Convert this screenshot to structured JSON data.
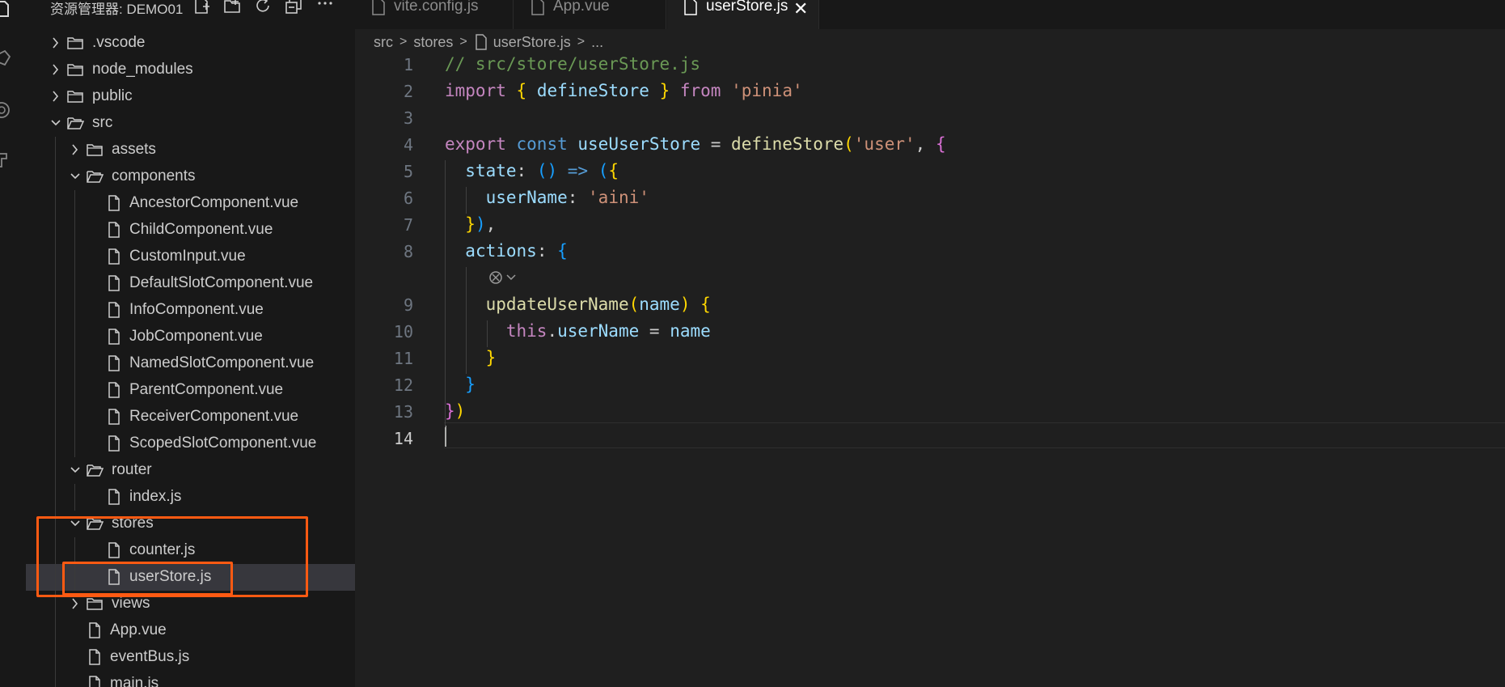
{
  "explorer": {
    "title": "资源管理器: DEMO01",
    "actions": [
      {
        "name": "new-file-icon"
      },
      {
        "name": "new-folder-icon"
      },
      {
        "name": "refresh-icon"
      },
      {
        "name": "collapse-all-icon"
      },
      {
        "name": "more-actions-icon"
      }
    ],
    "items": [
      {
        "label": ".vscode",
        "type": "folder",
        "depth": 0,
        "expanded": false
      },
      {
        "label": "node_modules",
        "type": "folder",
        "depth": 0,
        "expanded": false
      },
      {
        "label": "public",
        "type": "folder",
        "depth": 0,
        "expanded": false
      },
      {
        "label": "src",
        "type": "folder",
        "depth": 0,
        "expanded": true
      },
      {
        "label": "assets",
        "type": "folder",
        "depth": 1,
        "expanded": false
      },
      {
        "label": "components",
        "type": "folder",
        "depth": 1,
        "expanded": true
      },
      {
        "label": "AncestorComponent.vue",
        "type": "file",
        "depth": 2
      },
      {
        "label": "ChildComponent.vue",
        "type": "file",
        "depth": 2
      },
      {
        "label": "CustomInput.vue",
        "type": "file",
        "depth": 2
      },
      {
        "label": "DefaultSlotComponent.vue",
        "type": "file",
        "depth": 2
      },
      {
        "label": "InfoComponent.vue",
        "type": "file",
        "depth": 2
      },
      {
        "label": "JobComponent.vue",
        "type": "file",
        "depth": 2
      },
      {
        "label": "NamedSlotComponent.vue",
        "type": "file",
        "depth": 2
      },
      {
        "label": "ParentComponent.vue",
        "type": "file",
        "depth": 2
      },
      {
        "label": "ReceiverComponent.vue",
        "type": "file",
        "depth": 2
      },
      {
        "label": "ScopedSlotComponent.vue",
        "type": "file",
        "depth": 2
      },
      {
        "label": "router",
        "type": "folder",
        "depth": 1,
        "expanded": true
      },
      {
        "label": "index.js",
        "type": "file",
        "depth": 2
      },
      {
        "label": "stores",
        "type": "folder",
        "depth": 1,
        "expanded": true
      },
      {
        "label": "counter.js",
        "type": "file",
        "depth": 2
      },
      {
        "label": "userStore.js",
        "type": "file",
        "depth": 2,
        "selected": true
      },
      {
        "label": "views",
        "type": "folder",
        "depth": 1,
        "expanded": false
      },
      {
        "label": "App.vue",
        "type": "file",
        "depth": 1
      },
      {
        "label": "eventBus.js",
        "type": "file",
        "depth": 1
      },
      {
        "label": "main.js",
        "type": "file",
        "depth": 1
      }
    ]
  },
  "tabs": [
    {
      "label": "vite.config.js",
      "active": false
    },
    {
      "label": "App.vue",
      "active": false
    },
    {
      "label": "userStore.js",
      "active": true,
      "close": "✕"
    }
  ],
  "breadcrumb": {
    "parts": [
      "src",
      "stores",
      "userStore.js",
      "..."
    ],
    "separator": ">"
  },
  "editor": {
    "line_numbers": [
      "1",
      "2",
      "3",
      "4",
      "5",
      "6",
      "7",
      "8",
      "9",
      "10",
      "11",
      "12",
      "13",
      "14"
    ],
    "current_line": "14",
    "code": [
      [
        [
          "// src/store/userStore.js",
          "c"
        ]
      ],
      [
        [
          "import",
          "k"
        ],
        [
          " ",
          ""
        ],
        [
          "{",
          "b1"
        ],
        [
          " ",
          ""
        ],
        [
          "defineStore",
          "v"
        ],
        [
          " ",
          ""
        ],
        [
          "}",
          "b1"
        ],
        [
          " ",
          ""
        ],
        [
          "from",
          "k"
        ],
        [
          " ",
          ""
        ],
        [
          "'pinia'",
          "s"
        ]
      ],
      [],
      [
        [
          "export",
          "k"
        ],
        [
          " ",
          ""
        ],
        [
          "const",
          "kb"
        ],
        [
          " ",
          ""
        ],
        [
          "useUserStore",
          "v"
        ],
        [
          " = ",
          ""
        ],
        [
          "defineStore",
          "f"
        ],
        [
          "(",
          "b1"
        ],
        [
          "'user'",
          "s"
        ],
        [
          ", ",
          ""
        ],
        [
          "{",
          "b2"
        ]
      ],
      [
        [
          "  ",
          ""
        ],
        [
          "state",
          "v"
        ],
        [
          ": ",
          ""
        ],
        [
          "()",
          "b3"
        ],
        [
          " ",
          ""
        ],
        [
          "=>",
          "kb"
        ],
        [
          " ",
          ""
        ],
        [
          "(",
          "b3"
        ],
        [
          "{",
          "b1"
        ]
      ],
      [
        [
          "    ",
          ""
        ],
        [
          "userName",
          "v"
        ],
        [
          ": ",
          ""
        ],
        [
          "'aini'",
          "s"
        ]
      ],
      [
        [
          "  ",
          ""
        ],
        [
          "}",
          "b1"
        ],
        [
          ")",
          "b3"
        ],
        [
          ",",
          ""
        ]
      ],
      [
        [
          "  ",
          ""
        ],
        [
          "actions",
          "v"
        ],
        [
          ": ",
          ""
        ],
        [
          "{",
          "b3"
        ]
      ],
      [
        [
          "    ",
          ""
        ],
        [
          "updateUserName",
          "f"
        ],
        [
          "(",
          "b1"
        ],
        [
          "name",
          "v"
        ],
        [
          ")",
          "b1"
        ],
        [
          " ",
          ""
        ],
        [
          "{",
          "b1"
        ]
      ],
      [
        [
          "      ",
          ""
        ],
        [
          "this",
          "k"
        ],
        [
          ".",
          ""
        ],
        [
          "userName",
          "v"
        ],
        [
          " = ",
          ""
        ],
        [
          "name",
          "v"
        ]
      ],
      [
        [
          "    ",
          ""
        ],
        [
          "}",
          "b1"
        ]
      ],
      [
        [
          "  ",
          ""
        ],
        [
          "}",
          "b3"
        ]
      ],
      [
        [
          "}",
          "b2"
        ],
        [
          ")",
          "b1"
        ]
      ],
      []
    ]
  },
  "colors": {
    "highlight_box": "#ff5a12",
    "selection": "#37373d",
    "editor_bg": "#1f1f1f",
    "sidebar_bg": "#181818"
  }
}
